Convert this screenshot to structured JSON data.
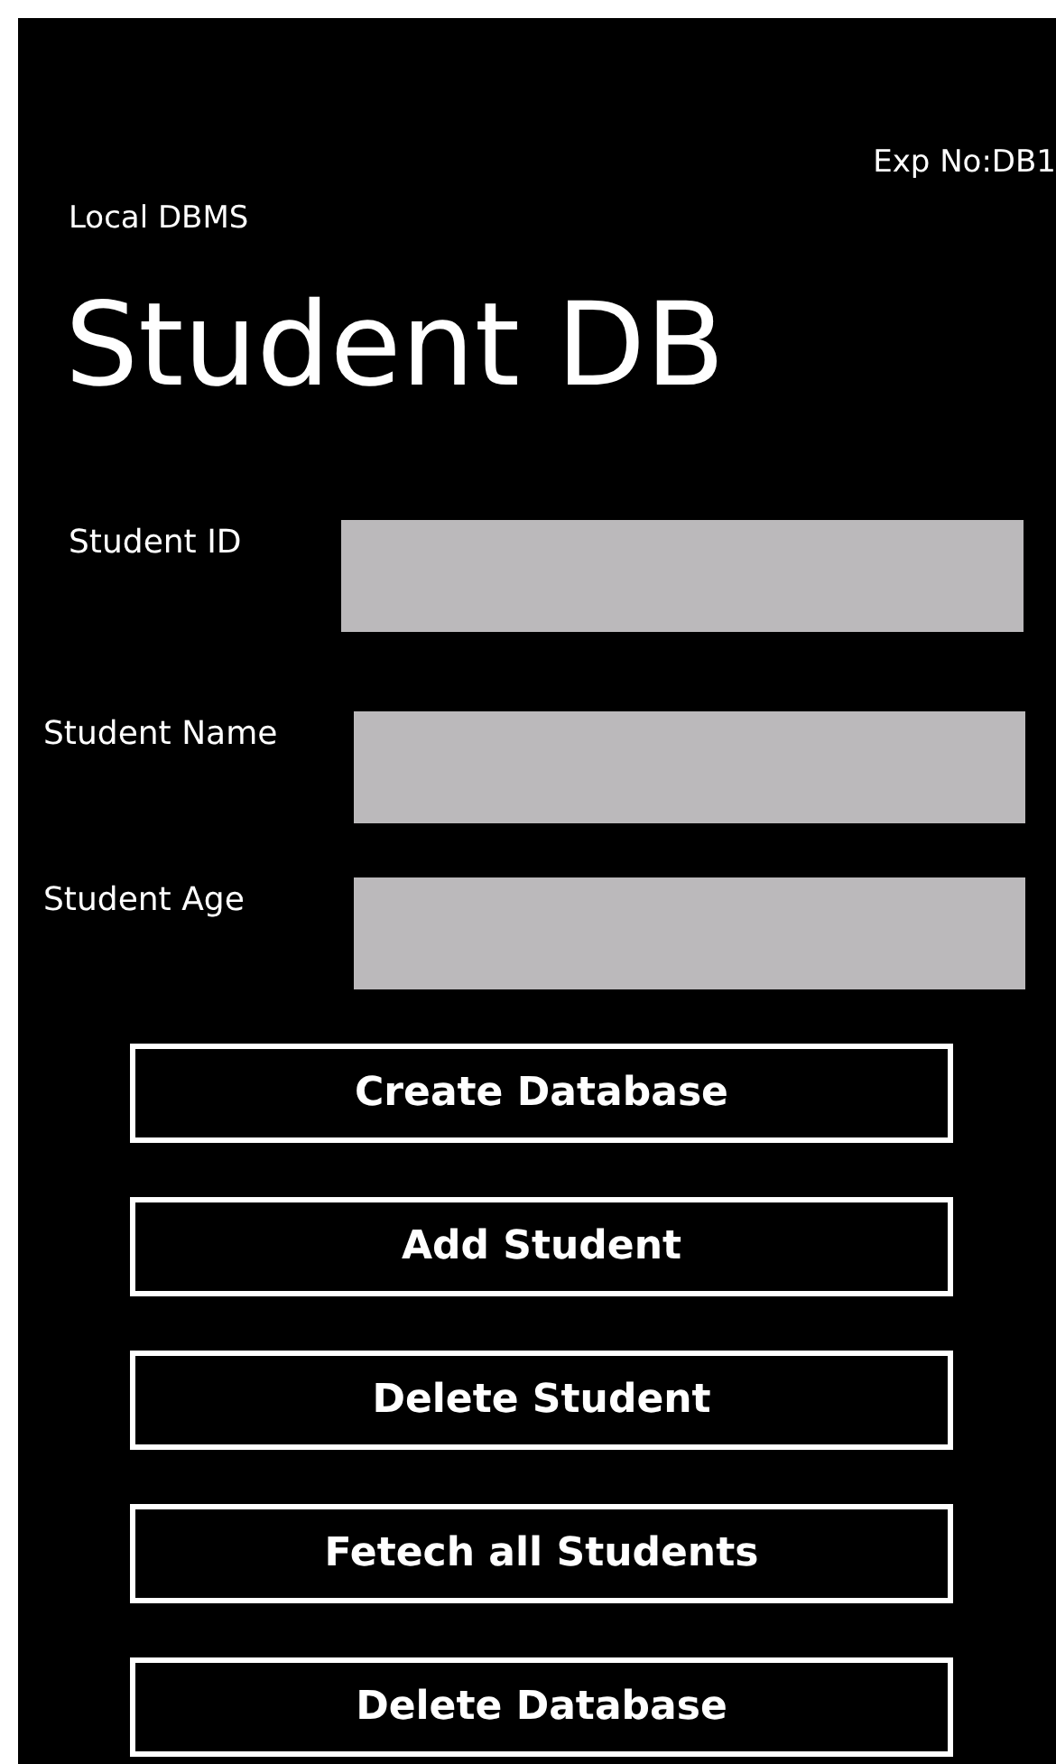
{
  "header": {
    "experiment": "Exp No:DB1",
    "app_name": "Local DBMS",
    "title": "Student DB"
  },
  "fields": [
    {
      "label": "Student ID"
    },
    {
      "label": "Student Name"
    },
    {
      "label": "Student Age"
    }
  ],
  "buttons": [
    "Create Database",
    "Add Student",
    "Delete Student",
    "Fetech all Students",
    "Delete Database"
  ]
}
